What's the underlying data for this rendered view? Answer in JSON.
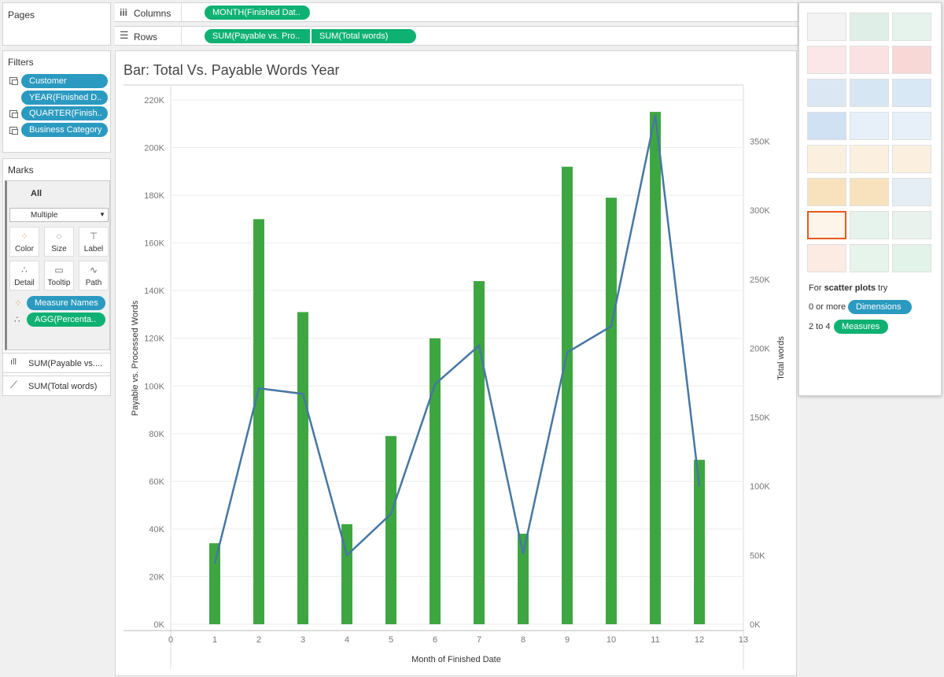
{
  "pages": {
    "title": "Pages"
  },
  "shelves": {
    "columns_label": "Columns",
    "columns_pills": [
      "MONTH(Finished Dat.."
    ],
    "rows_label": "Rows",
    "rows_pills": [
      "SUM(Payable  vs. Pro..",
      "SUM(Total words)"
    ]
  },
  "filters": {
    "title": "Filters",
    "items": [
      "Customer",
      "YEAR(Finished D..",
      "QUARTER(Finish..",
      "Business Category"
    ]
  },
  "marks": {
    "title": "Marks",
    "all_label": "All",
    "type_value": "Multiple",
    "buttons": [
      "Color",
      "Size",
      "Label",
      "Detail",
      "Tooltip",
      "Path"
    ],
    "pills": [
      "Measure Names",
      "AGG(Percenta.."
    ],
    "cards": [
      "SUM(Payable  vs....",
      "SUM(Total words)"
    ]
  },
  "chart_data": {
    "type": "bar",
    "title": "Bar: Total Vs. Payable Words Year",
    "xlabel": "Month of Finished Date",
    "ylabel": "Payable vs. Processed Words",
    "y2label": "Total words",
    "x_ticks": [
      "0",
      "1",
      "2",
      "3",
      "4",
      "5",
      "6",
      "7",
      "8",
      "9",
      "10",
      "11",
      "12",
      "13"
    ],
    "xlim": [
      0,
      13
    ],
    "ylim": [
      0,
      220000
    ],
    "y2lim": [
      0,
      380000
    ],
    "y_ticks": [
      "0K",
      "20K",
      "40K",
      "60K",
      "80K",
      "100K",
      "120K",
      "140K",
      "160K",
      "180K",
      "200K",
      "220K"
    ],
    "y2_ticks": [
      "0K",
      "50K",
      "100K",
      "150K",
      "200K",
      "250K",
      "300K",
      "350K"
    ],
    "bar_color": "#3ea641",
    "line_color": "#4677a3",
    "categories": [
      1,
      2,
      3,
      4,
      5,
      6,
      7,
      8,
      9,
      10,
      11,
      12
    ],
    "series": [
      {
        "axis": "left",
        "kind": "bar",
        "values": [
          34000,
          170000,
          131000,
          42000,
          79000,
          120000,
          144000,
          38000,
          192000,
          179000,
          215000,
          69000
        ]
      },
      {
        "axis": "right",
        "kind": "line",
        "values": [
          44000,
          171000,
          167000,
          50000,
          80000,
          174000,
          202000,
          51000,
          197000,
          216000,
          369000,
          100000
        ]
      }
    ]
  },
  "show_me": {
    "hint_prefix": "For ",
    "hint_bold": "scatter plots",
    "hint_suffix": " try",
    "dims_prefix": "0 or more",
    "dims_pill": "Dimensions",
    "meas_prefix": "2 to 4",
    "meas_pill": "Measures"
  }
}
